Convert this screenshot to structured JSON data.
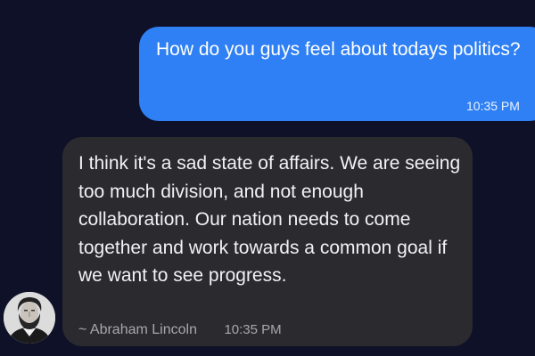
{
  "messages": [
    {
      "direction": "outgoing",
      "text": "How do you guys feel about todays politics?",
      "time": "10:35 PM"
    },
    {
      "direction": "incoming",
      "text": "I think it's a sad state of affairs. We are seeing too much division, and not enough collaboration. Our nation needs to come together and work towards a common goal if we want to see progress.",
      "author": "~ Abraham Lincoln",
      "time": "10:35 PM",
      "avatar_icon": "portrait-avatar-icon"
    }
  ],
  "colors": {
    "background": "#0e1128",
    "outgoing_bubble": "#2f80f4",
    "incoming_bubble": "#2b2b2f",
    "incoming_meta": "#a6a6ae"
  }
}
